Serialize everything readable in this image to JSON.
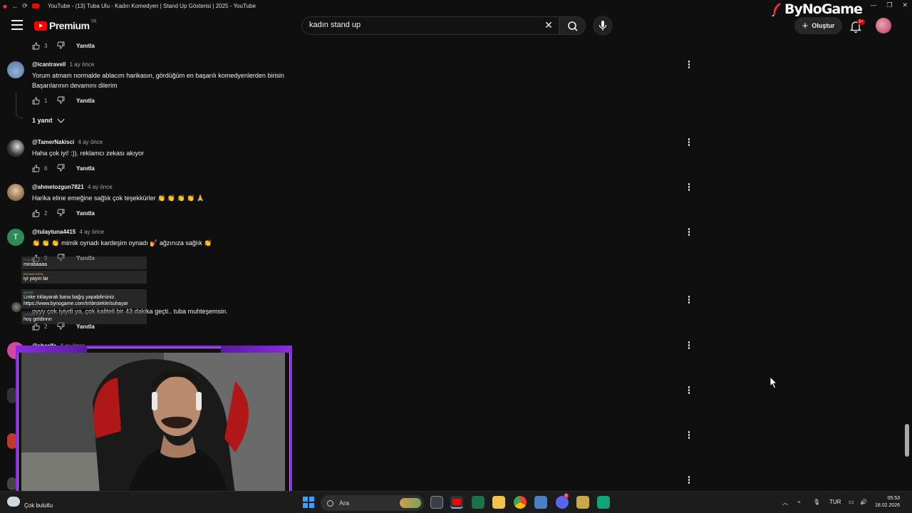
{
  "window": {
    "title": "YouTube - (13) Tuba Ulu - Kadın Komedyen | Stand Up Gösterisi | 2025 - YouTube",
    "brand": "ByNoGame"
  },
  "header": {
    "logo_text": "Premium",
    "logo_region": "TR",
    "search": {
      "value": "kadın stand up",
      "placeholder": "Ara"
    },
    "create_label": "Oluştur",
    "notif_count": "9+"
  },
  "top_actions": {
    "likes": "3",
    "reply_label": "Yanıtla"
  },
  "comments": [
    {
      "author": "@icantravell",
      "time": "1 ay önce",
      "lines": [
        "Yorum atmam normalde ablacım harikasın, gördüğüm en başarılı komedyenlerden birisin",
        "Başarılarının devamını dilerim"
      ],
      "likes": "1",
      "reply_label": "Yanıtla",
      "replies_label": "1 yanıt"
    },
    {
      "author": "@TamerNakisci",
      "time": "4 ay önce",
      "lines": [
        "Haha çok iyi! :)). reklamcı zekası akıyor"
      ],
      "likes": "6",
      "reply_label": "Yanıtla"
    },
    {
      "author": "@ahmetozgun7821",
      "time": "4 ay önce",
      "lines": [
        "Harika eline emeğine sağlık çok teşekkürler 👏 👏 👏 👏 🙏"
      ],
      "likes": "2",
      "reply_label": "Yanıtla"
    },
    {
      "author": "@tulaytuna4415",
      "avatar_letter": "T",
      "time": "4 ay önce",
      "lines": [
        "👏 👏 👏  mimik oynadı kardeşim oynadı 💅  ağzınıza sağlık 👏"
      ],
      "likes": "9",
      "reply_label": "Yanıtla"
    },
    {
      "author": "",
      "time": "",
      "lines": [
        "oyyy çok iyiydi ya, çok kaliteli bir 43 dakika geçti.. tuba muhteşemsin."
      ],
      "likes": "2",
      "reply_label": "Yanıtla"
    },
    {
      "author": "@sherife",
      "time": "4 ay önce",
      "lines": []
    }
  ],
  "chat": [
    {
      "user": "CYCLES",
      "text": "mirabaaaa"
    },
    {
      "user": "BAYBATUGEM",
      "text": "iyi yayın lar"
    },
    {
      "user": "BOTEN",
      "text": "Linke tıklayarak bana bağış yapabilirsiniz. https://www.bynogame.com/tr/destekle/suhayar"
    },
    {
      "user": "CYCLES",
      "text": "hoş geldinnn"
    }
  ],
  "taskbar": {
    "weather": "Çok bulutlu",
    "search_label": "Ara",
    "language": "TUR",
    "time": "05:53",
    "date": "18.02.2026",
    "discord_badge": "9"
  },
  "colors": {
    "accent": "#ff0000",
    "frame": "#8a2be2",
    "bg": "#0f0f0f"
  }
}
